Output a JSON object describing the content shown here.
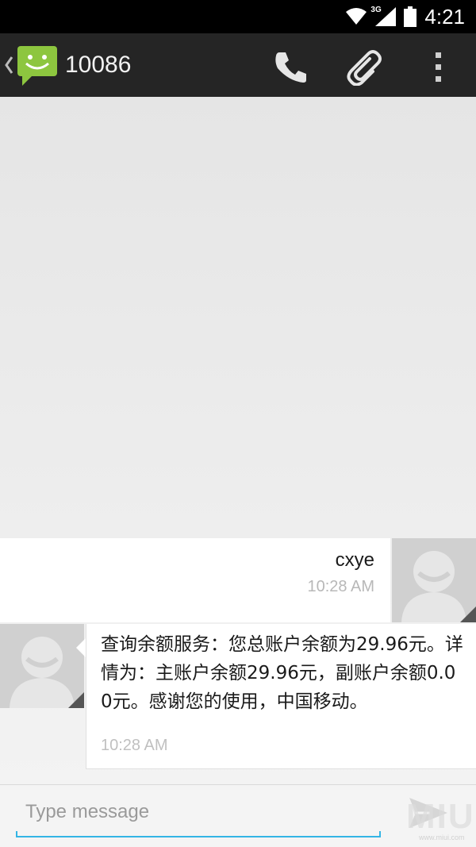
{
  "status_bar": {
    "time": "4:21",
    "network": "3G",
    "icons": [
      "wifi-icon",
      "signal-icon",
      "battery-icon"
    ]
  },
  "action_bar": {
    "title": "10086",
    "icons": [
      "back-chevron-icon",
      "messaging-app-icon",
      "phone-icon",
      "paperclip-icon",
      "overflow-menu-icon"
    ]
  },
  "messages": [
    {
      "direction": "outgoing",
      "text": "cxye",
      "time": "10:28 AM"
    },
    {
      "direction": "incoming",
      "text": "查询余额服务：您总账户余额为29.96元。详情为：主账户余额29.96元，副账户余额0.00元。感谢您的使用，中国移动。",
      "time": "10:28 AM"
    }
  ],
  "compose": {
    "placeholder": "Type message",
    "value": "",
    "send_icon": "send-icon"
  },
  "watermark": {
    "text": "MIUI",
    "sub": "www.miui.com"
  },
  "colors": {
    "accent": "#33b5e5",
    "action_bar": "#252525",
    "status_bar": "#000000",
    "app_icon": "#8dc63f"
  }
}
